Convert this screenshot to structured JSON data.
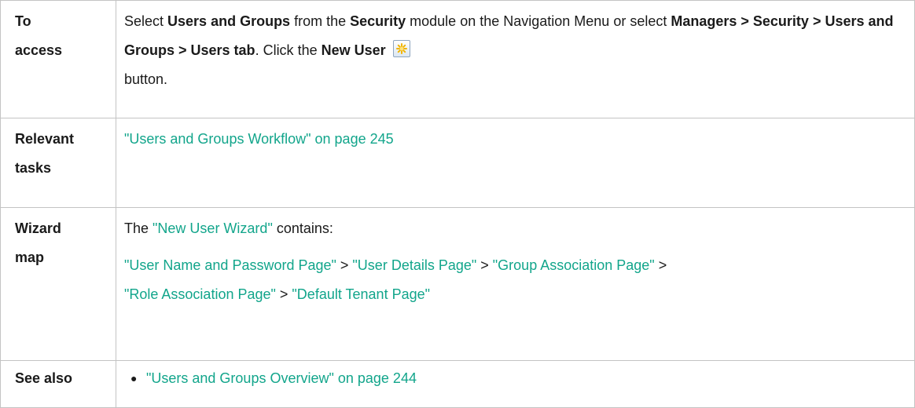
{
  "access": {
    "label_line1": "To",
    "label_line2": "access",
    "text1": "Select ",
    "b1": "Users and Groups",
    "text2": " from the ",
    "b2": "Security",
    "text3": " module on the Navigation Menu or select ",
    "b3": "Managers > Security > Users and Groups > Users tab",
    "text4": ". Click the ",
    "b4": "New User",
    "icon": "new-user-icon",
    "text5": "button."
  },
  "relevant": {
    "label_line1": "Relevant",
    "label_line2": "tasks",
    "link": "\"Users and Groups Workflow\" on page 245"
  },
  "wizard": {
    "label_line1": "Wizard",
    "label_line2": "map",
    "text1": "The ",
    "link1": "\"New User Wizard\"",
    "text2": " contains:",
    "pages": [
      "\"User Name and Password Page\"",
      "\"User Details Page\"",
      "\"Group Association Page\"",
      "\"Role Association Page\"",
      "\"Default Tenant Page\""
    ],
    "separator": " > "
  },
  "see_also": {
    "label": "See also",
    "items": [
      "\"Users and Groups Overview\" on page 244"
    ]
  },
  "colors": {
    "link": "#12a58b",
    "border": "#c4c4c4"
  }
}
